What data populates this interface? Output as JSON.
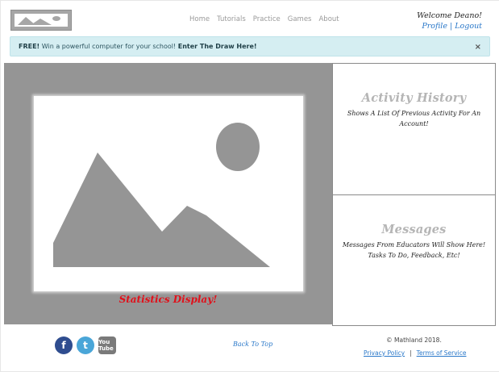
{
  "header": {
    "nav": [
      "Home",
      "Tutorials",
      "Practice",
      "Games",
      "About"
    ],
    "welcome": "Welcome Deano!",
    "profile_label": "Profile",
    "separator": "|",
    "logout_label": "Logout"
  },
  "alert": {
    "free": "FREE!",
    "text": " Win a powerful computer for your school! ",
    "link": "Enter The Draw Here!",
    "close": "×"
  },
  "stats": {
    "label": "Statistics Display!"
  },
  "activity": {
    "title": "Activity History",
    "desc": "Shows A List Of Previous Activity For An Account!"
  },
  "messages": {
    "title": "Messages",
    "desc": "Messages From Educators Will Show Here! Tasks To Do, Feedback, Etc!"
  },
  "footer": {
    "back_to_top": "Back To Top",
    "copyright": "© Mathland 2018.",
    "privacy": "Privacy Policy",
    "sep": "|",
    "terms": "Terms of Service",
    "social": [
      "f",
      "t",
      "You Tube"
    ]
  },
  "colors": {
    "accent": "#2a78c9",
    "alert_bg": "#d5eef2",
    "stats_label": "#e0101a",
    "placeholder_gray": "#959595"
  }
}
